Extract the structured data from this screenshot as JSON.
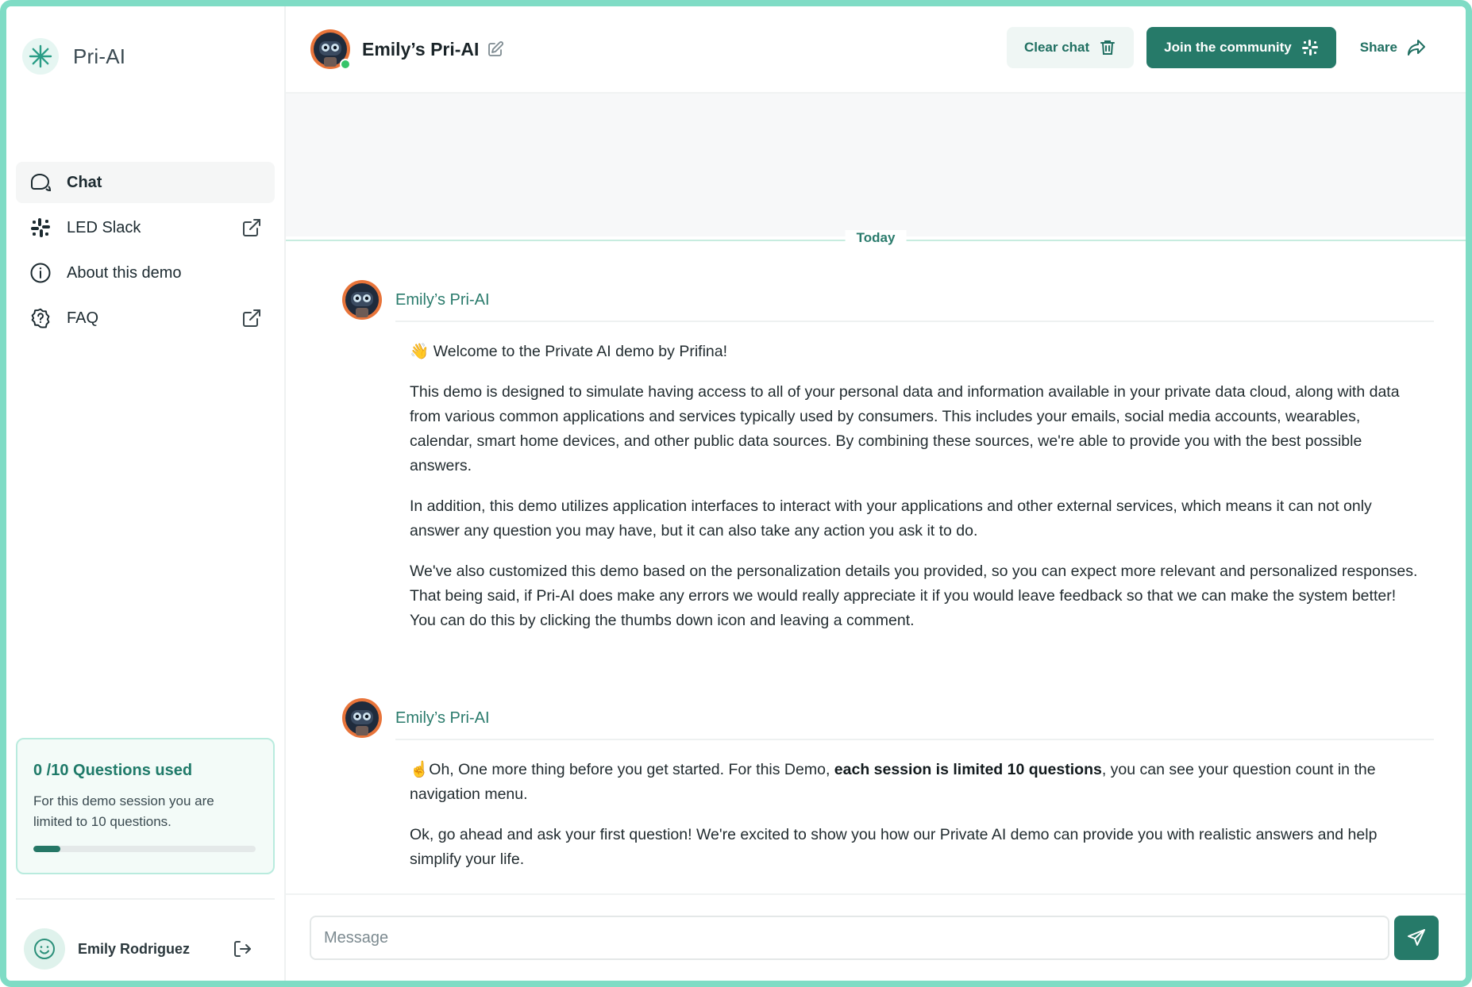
{
  "app": {
    "name": "Pri-AI"
  },
  "sidebar": {
    "items": [
      {
        "label": "Chat",
        "icon": "chat-bubble-icon",
        "active": true,
        "external": false
      },
      {
        "label": "LED Slack",
        "icon": "slack-icon",
        "active": false,
        "external": true
      },
      {
        "label": "About this demo",
        "icon": "info-icon",
        "active": false,
        "external": false
      },
      {
        "label": "FAQ",
        "icon": "question-badge-icon",
        "active": false,
        "external": true
      }
    ],
    "quota": {
      "title": "0 /10 Questions used",
      "text": "For this demo session you are limited to 10 questions.",
      "used": 0,
      "max": 10,
      "progress_fraction": 0.12
    },
    "user": {
      "name": "Emily Rodriguez"
    }
  },
  "header": {
    "title": "Emily’s Pri-AI",
    "status": "online",
    "clear_label": "Clear chat",
    "join_label": "Join the community",
    "share_label": "Share"
  },
  "chat": {
    "date_divider": "Today",
    "messages": [
      {
        "sender": "Emily’s Pri-AI",
        "paragraphs": [
          "👋 Welcome to the Private AI demo by Prifina!",
          "This demo is designed to simulate having access to all of your personal data and information available in your private data cloud, along with data from various common applications and services typically used by consumers. This includes your emails, social media accounts, wearables, calendar, smart home devices, and other public data sources. By combining these sources, we're able to provide you with the best possible answers.",
          "In addition, this demo utilizes application interfaces to interact with your applications and other external services, which means it can not only answer any question you may have, but it can also take any action you ask it to do.",
          "We've also customized this demo based on the personalization details you provided, so you can expect more relevant and personalized responses. That being said, if Pri-AI does make any errors we would really appreciate it if you would leave feedback so that we can make the system better! You can do this by clicking the thumbs down  icon and leaving a comment."
        ]
      },
      {
        "sender": "Emily’s Pri-AI",
        "p1_before": "☝️Oh, One more thing before you get started. For this Demo, ",
        "p1_bold": "each session is limited 10 questions",
        "p1_after": ", you can see your question count in the navigation menu.",
        "p2": "Ok, go ahead and ask your first question! We're excited to show you how our Private AI demo can provide you with realistic answers and help simplify your life."
      }
    ]
  },
  "composer": {
    "placeholder": "Message",
    "value": ""
  },
  "colors": {
    "accent": "#267a69",
    "accent_light": "#eff6f4",
    "border": "#7fdcc5"
  }
}
